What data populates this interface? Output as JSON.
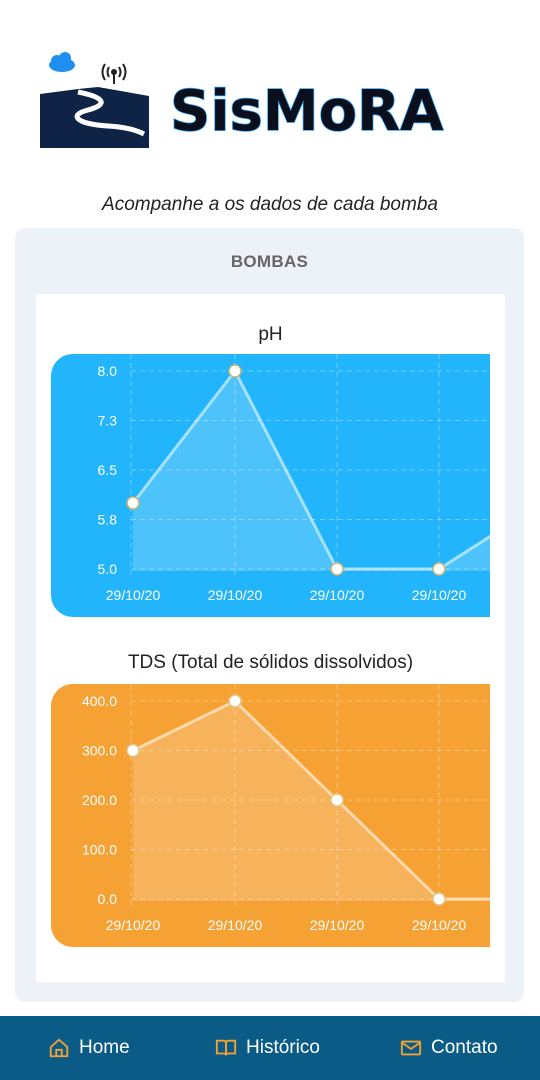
{
  "app": {
    "name": "SisMoRA"
  },
  "subtitle": "Acompanhe a os dados de cada bomba",
  "card": {
    "title": "BOMBAS"
  },
  "colors": {
    "ph_chart": "#22b5fb",
    "tds_chart": "#f5a133",
    "nav_bar": "#0a5c86",
    "nav_icon": "#f5a133"
  },
  "chart_data": [
    {
      "type": "area",
      "title": "pH",
      "categories": [
        "29/10/20",
        "29/10/20",
        "29/10/20",
        "29/10/20"
      ],
      "values": [
        6.0,
        8.0,
        5.0,
        5.0
      ],
      "yticks": [
        "8.0",
        "7.3",
        "6.5",
        "5.8",
        "5.0"
      ],
      "ylim": [
        5.0,
        8.0
      ],
      "grid": true
    },
    {
      "type": "area",
      "title": "TDS (Total de sólidos dissolvidos)",
      "categories": [
        "29/10/20",
        "29/10/20",
        "29/10/20",
        "29/10/20"
      ],
      "values": [
        300,
        400,
        200,
        0
      ],
      "yticks": [
        "400.0",
        "300.0",
        "200.0",
        "100.0",
        "0.0"
      ],
      "ylim": [
        0,
        400
      ],
      "grid": true
    }
  ],
  "nav": [
    {
      "label": "Home",
      "icon": "home-icon"
    },
    {
      "label": "Histórico",
      "icon": "book-icon"
    },
    {
      "label": "Contato",
      "icon": "mail-icon"
    }
  ]
}
